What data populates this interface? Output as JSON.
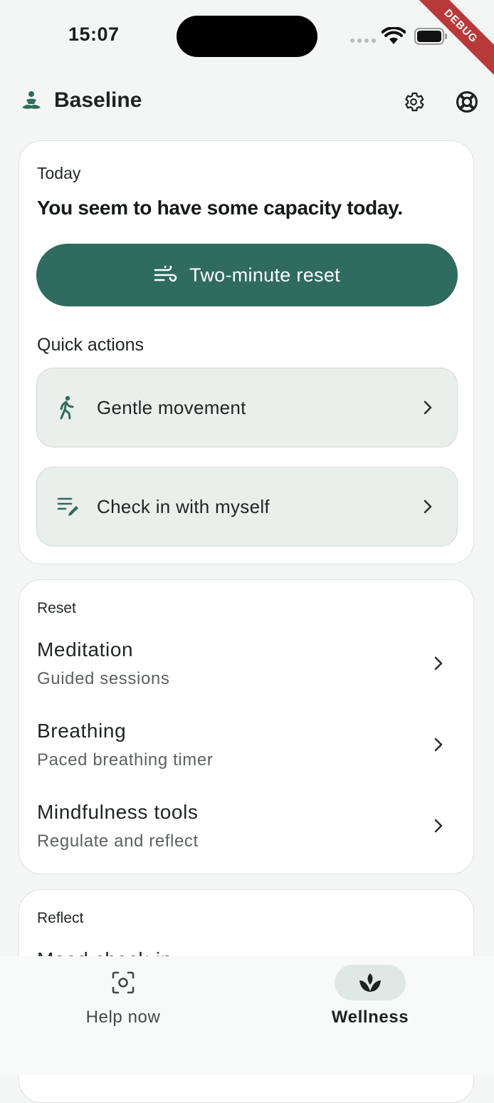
{
  "status_bar": {
    "time": "15:07",
    "debug_banner": "DEBUG"
  },
  "header": {
    "app_title": "Baseline",
    "logo_icon": "meditation-person-icon",
    "settings_icon": "gear-icon",
    "support_icon": "lifebuoy-icon"
  },
  "today": {
    "label": "Today",
    "message": "You seem to have some capacity today.",
    "primary_action": {
      "label": "Two-minute reset",
      "icon": "wind-icon"
    },
    "quick_actions_title": "Quick actions",
    "quick_actions": [
      {
        "label": "Gentle movement",
        "icon": "walking-person-icon"
      },
      {
        "label": "Check in with myself",
        "icon": "edit-note-icon"
      }
    ]
  },
  "reset": {
    "label": "Reset",
    "items": [
      {
        "title": "Meditation",
        "subtitle": "Guided sessions"
      },
      {
        "title": "Breathing",
        "subtitle": "Paced breathing timer"
      },
      {
        "title": "Mindfulness tools",
        "subtitle": "Regulate and reflect"
      }
    ]
  },
  "reflect": {
    "label": "Reflect",
    "items": [
      {
        "title": "Mood check-in"
      }
    ]
  },
  "bottom_nav": {
    "items": [
      {
        "label": "Help now",
        "icon": "focus-camera-icon",
        "selected": false
      },
      {
        "label": "Wellness",
        "icon": "spa-leaf-icon",
        "selected": true
      }
    ]
  },
  "colors": {
    "primary": "#2f6b5f",
    "background": "#f4f6f5",
    "tile": "#eaefec",
    "nav_pill": "#dfe8e4"
  }
}
